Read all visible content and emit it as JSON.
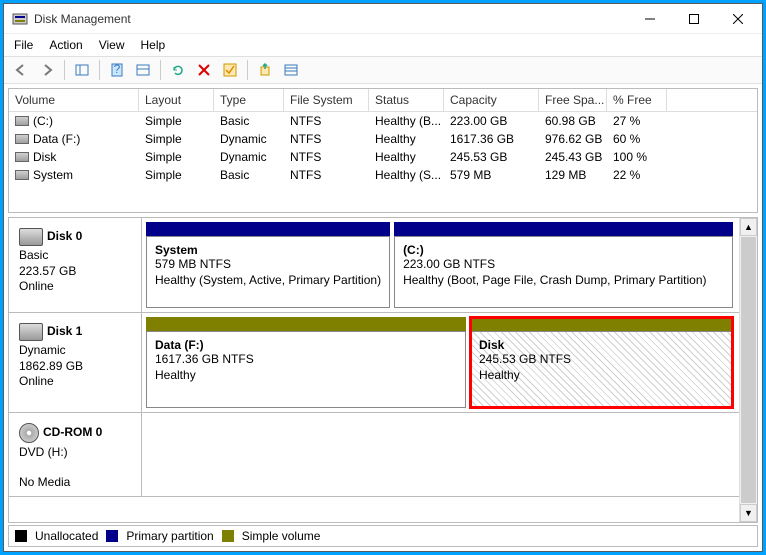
{
  "title": "Disk Management",
  "menu": {
    "file": "File",
    "action": "Action",
    "view": "View",
    "help": "Help"
  },
  "columns": {
    "volume": "Volume",
    "layout": "Layout",
    "type": "Type",
    "fs": "File System",
    "status": "Status",
    "capacity": "Capacity",
    "free": "Free Spa...",
    "pct": "% Free"
  },
  "rows": [
    {
      "vol": "(C:)",
      "layout": "Simple",
      "type": "Basic",
      "fs": "NTFS",
      "status": "Healthy (B...",
      "cap": "223.00 GB",
      "free": "60.98 GB",
      "pct": "27 %"
    },
    {
      "vol": "Data (F:)",
      "layout": "Simple",
      "type": "Dynamic",
      "fs": "NTFS",
      "status": "Healthy",
      "cap": "1617.36 GB",
      "free": "976.62 GB",
      "pct": "60 %"
    },
    {
      "vol": "Disk",
      "layout": "Simple",
      "type": "Dynamic",
      "fs": "NTFS",
      "status": "Healthy",
      "cap": "245.53 GB",
      "free": "245.43 GB",
      "pct": "100 %"
    },
    {
      "vol": "System",
      "layout": "Simple",
      "type": "Basic",
      "fs": "NTFS",
      "status": "Healthy (S...",
      "cap": "579 MB",
      "free": "129 MB",
      "pct": "22 %"
    }
  ],
  "disks": {
    "d0": {
      "name": "Disk 0",
      "type": "Basic",
      "size": "223.57 GB",
      "status": "Online"
    },
    "d1": {
      "name": "Disk 1",
      "type": "Dynamic",
      "size": "1862.89 GB",
      "status": "Online"
    },
    "cd": {
      "name": "CD-ROM 0",
      "type": "DVD (H:)",
      "status": "No Media"
    }
  },
  "parts": {
    "system": {
      "name": "System",
      "size": "579 MB NTFS",
      "status": "Healthy (System, Active, Primary Partition)"
    },
    "c": {
      "name": "(C:)",
      "size": "223.00 GB NTFS",
      "status": "Healthy (Boot, Page File, Crash Dump, Primary Partition)"
    },
    "data": {
      "name": "Data  (F:)",
      "size": "1617.36 GB NTFS",
      "status": "Healthy"
    },
    "disk": {
      "name": "Disk",
      "size": "245.53 GB NTFS",
      "status": "Healthy"
    }
  },
  "legend": {
    "unalloc": "Unallocated",
    "primary": "Primary partition",
    "simple": "Simple volume"
  }
}
